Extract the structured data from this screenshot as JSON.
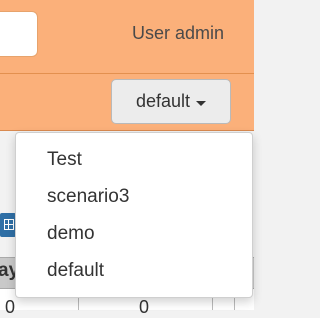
{
  "header": {
    "user_label": "User admin"
  },
  "scenario_selector": {
    "selected": "default",
    "options": [
      "Test",
      "scenario3",
      "demo",
      "default"
    ]
  },
  "table": {
    "header_partial": "ay",
    "row_values": [
      "0",
      "0"
    ]
  },
  "colors": {
    "topbar": "#fbb07a",
    "icon_blue": "#2f6fa6"
  },
  "icons": {
    "table": "table-icon",
    "caret": "caret-down-icon"
  }
}
